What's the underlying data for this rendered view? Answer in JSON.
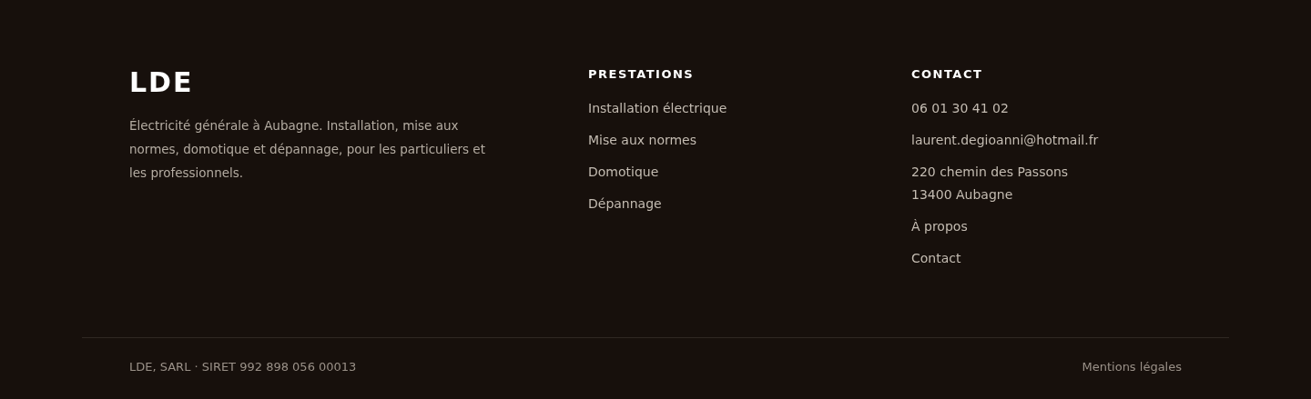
{
  "brand": {
    "logo": "LDE",
    "description": "Électricité générale à Aubagne. Installation, mise aux normes, domotique et dépannage, pour les particuliers et les professionnels."
  },
  "columns": [
    {
      "title": "PRESTATIONS",
      "items": [
        {
          "kind": "link",
          "text": "Installation électrique"
        },
        {
          "kind": "link",
          "text": "Mise aux normes"
        },
        {
          "kind": "link",
          "text": "Domotique"
        },
        {
          "kind": "link",
          "text": "Dépannage"
        }
      ]
    },
    {
      "title": "CONTACT",
      "items": [
        {
          "kind": "link",
          "text": "06 01 30 41 02"
        },
        {
          "kind": "link",
          "text": "laurent.degioanni@hotmail.fr"
        },
        {
          "kind": "address",
          "lines": [
            "220 chemin des Passons",
            "13400 Aubagne"
          ]
        },
        {
          "kind": "link",
          "text": "À propos"
        },
        {
          "kind": "link",
          "text": "Contact"
        }
      ]
    }
  ],
  "bottom": {
    "legal": "LDE, SARL · SIRET 992 898 056 00013",
    "link": "Mentions légales"
  }
}
